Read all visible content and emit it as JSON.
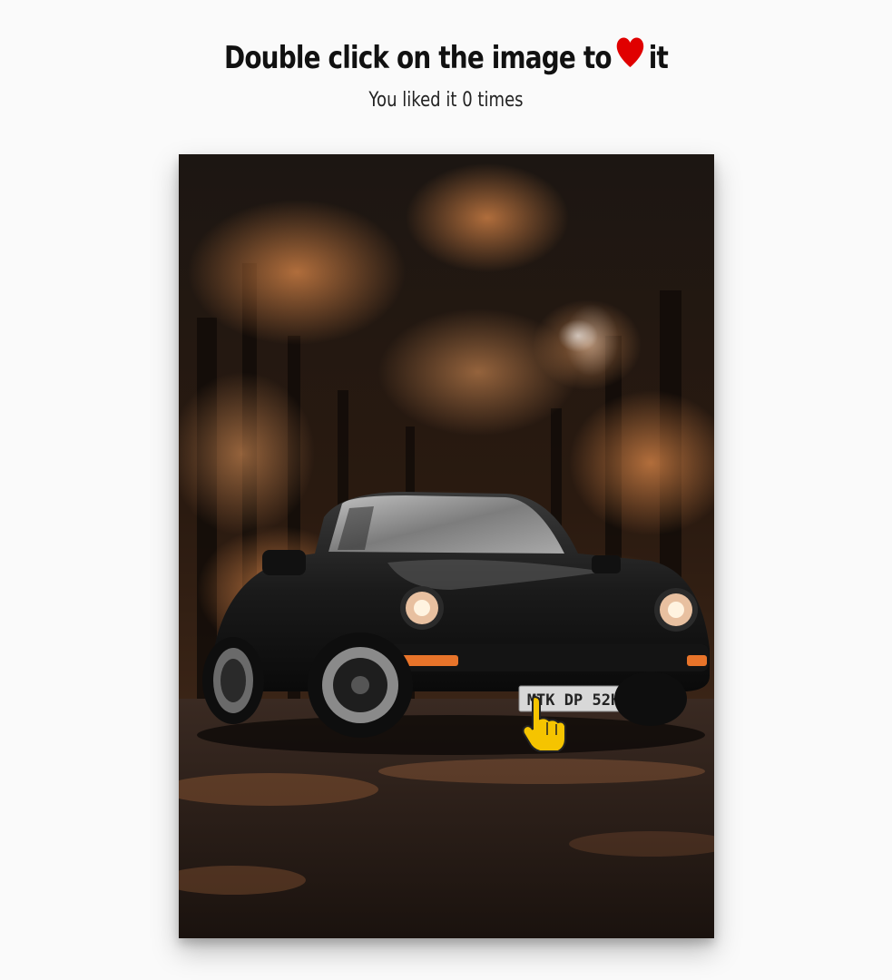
{
  "header": {
    "title_prefix": "Double click on the image to",
    "title_suffix": "it",
    "heart_icon": "heart-icon",
    "heart_color": "#e00000"
  },
  "counter": {
    "prefix": "You liked it",
    "count": "0",
    "suffix": "times"
  },
  "photo": {
    "plate_text": "MTK DP 52H",
    "cursor_icon": "pointing-hand-icon",
    "cursor_color": "#f5c400"
  }
}
